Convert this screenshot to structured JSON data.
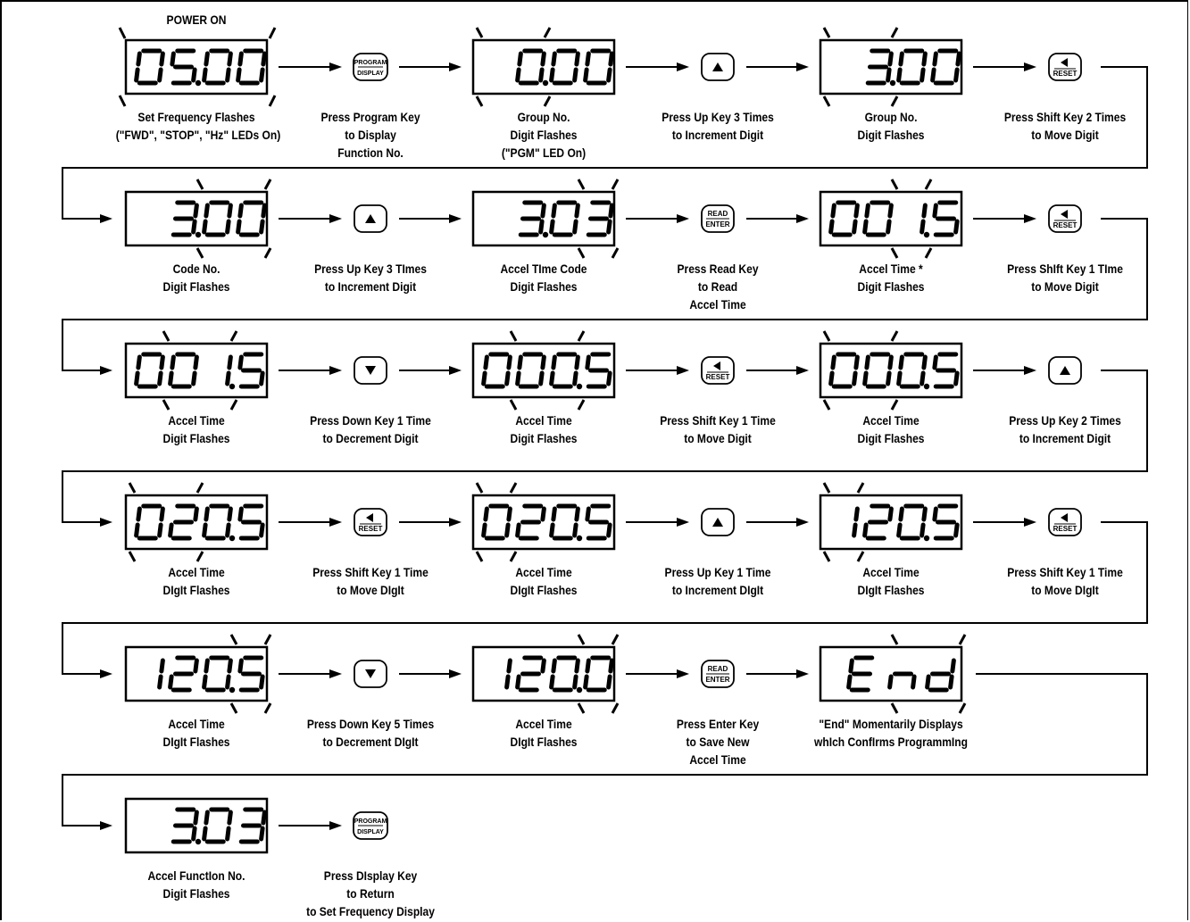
{
  "header": "POWER ON",
  "steps": [
    {
      "type": "display",
      "value": "05.00",
      "caption": [
        "Set Frequency Flashes",
        "(\"FWD\", \"STOP\", \"Hz\" LEDs On)"
      ]
    },
    {
      "type": "key",
      "key": "program",
      "caption": [
        "Press Program Key",
        "to Display",
        "Function No."
      ]
    },
    {
      "type": "display",
      "value": "0.00",
      "caption": [
        "Group No.",
        "Digit Flashes",
        "(\"PGM\" LED On)"
      ]
    },
    {
      "type": "key",
      "key": "up",
      "caption": [
        "Press Up Key 3 Times",
        "to Increment Digit"
      ]
    },
    {
      "type": "display",
      "value": "3.00",
      "caption": [
        "Group No.",
        "Digit Flashes"
      ]
    },
    {
      "type": "key",
      "key": "reset",
      "caption": [
        "Press Shift Key 2 Times",
        "to Move Digit"
      ]
    },
    {
      "type": "display",
      "value": "3.00",
      "caption": [
        "Code No.",
        "Digit Flashes"
      ]
    },
    {
      "type": "key",
      "key": "up",
      "caption": [
        "Press Up Key 3 TImes",
        "to Increment Digit"
      ]
    },
    {
      "type": "display",
      "value": "3.03",
      "caption": [
        "Accel TIme Code",
        "Digit Flashes"
      ]
    },
    {
      "type": "key",
      "key": "read",
      "caption": [
        "Press Read Key",
        "to Read",
        "Accel Time"
      ]
    },
    {
      "type": "display",
      "value": "001.5",
      "caption": [
        "Accel Time *",
        "Digit Flashes"
      ]
    },
    {
      "type": "key",
      "key": "reset",
      "caption": [
        "Press ShIft Key 1 TIme",
        "to Move Digit"
      ]
    },
    {
      "type": "display",
      "value": "001.5",
      "caption": [
        "Accel Time",
        "Digit Flashes"
      ]
    },
    {
      "type": "key",
      "key": "down",
      "caption": [
        "Press Down Key 1 Time",
        "to Decrement Digit"
      ]
    },
    {
      "type": "display",
      "value": "000.5",
      "caption": [
        "Accel Time",
        "Digit Flashes"
      ]
    },
    {
      "type": "key",
      "key": "reset",
      "caption": [
        "Press Shift Key 1 Time",
        "to Move Digit"
      ]
    },
    {
      "type": "display",
      "value": "000.5",
      "caption": [
        "Accel Time",
        "Digit Flashes"
      ]
    },
    {
      "type": "key",
      "key": "up",
      "caption": [
        "Press Up Key 2 Times",
        "to Increment Digit"
      ]
    },
    {
      "type": "display",
      "value": "020.5",
      "caption": [
        "Accel Time",
        "DIgIt Flashes"
      ]
    },
    {
      "type": "key",
      "key": "reset",
      "caption": [
        "Press Shift Key 1 Time",
        "to Move DIgIt"
      ]
    },
    {
      "type": "display",
      "value": "020.5",
      "caption": [
        "Accel Time",
        "DIgIt Flashes"
      ]
    },
    {
      "type": "key",
      "key": "up",
      "caption": [
        "Press Up Key 1 Time",
        "to Increment DIgIt"
      ]
    },
    {
      "type": "display",
      "value": "120.5",
      "caption": [
        "Accel Time",
        "DIgIt Flashes"
      ]
    },
    {
      "type": "key",
      "key": "reset",
      "caption": [
        "Press Shift Key 1 Time",
        "to Move DIgIt"
      ]
    },
    {
      "type": "display",
      "value": "120.5",
      "caption": [
        "Accel Time",
        "DIgIt Flashes"
      ]
    },
    {
      "type": "key",
      "key": "down",
      "caption": [
        "Press Down Key 5 Times",
        "to Decrement DIgIt"
      ]
    },
    {
      "type": "display",
      "value": "120.0",
      "caption": [
        "Accel Time",
        "DIgIt Flashes"
      ]
    },
    {
      "type": "key",
      "key": "read",
      "caption": [
        "Press Enter Key",
        "to Save New",
        "Accel Time"
      ]
    },
    {
      "type": "display",
      "value": "End",
      "caption": [
        "\"End\" Momentarily Displays",
        "whIch ConfIrms ProgrammIng"
      ]
    },
    {
      "type": "display",
      "value": "3.03",
      "caption": [
        "Accel FunctIon No.",
        "Digit Flashes"
      ]
    },
    {
      "type": "key",
      "key": "program",
      "caption": [
        "Press DIsplay Key",
        "to Return",
        "to Set Frequency Display"
      ]
    }
  ],
  "key_labels": {
    "program": [
      "PROGRAM",
      "DISPLAY"
    ],
    "read": [
      "READ",
      "ENTER"
    ],
    "reset": "RESET",
    "up": "up-arrow-icon",
    "down": "down-arrow-icon"
  }
}
